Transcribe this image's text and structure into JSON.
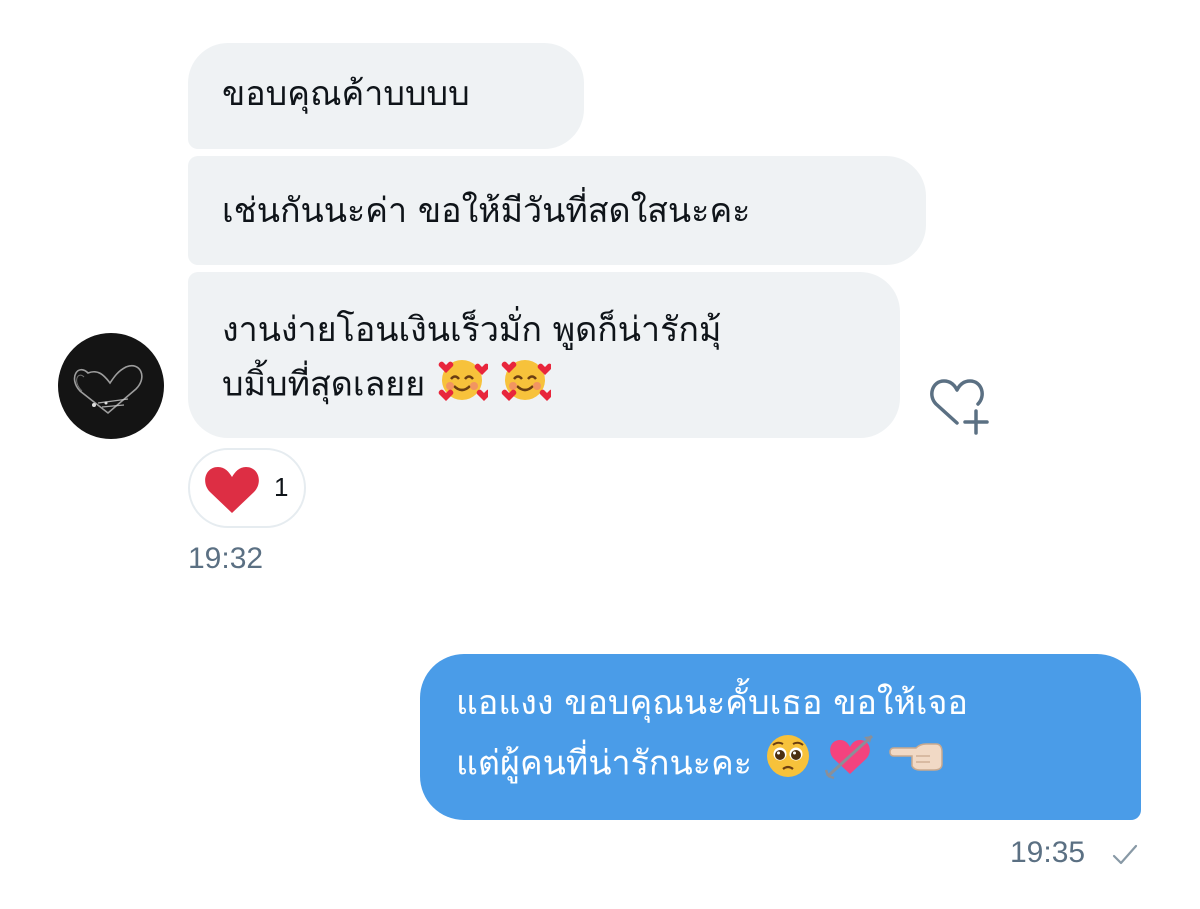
{
  "incoming": {
    "messages": [
      {
        "lines": [
          "ขอบคุณค้าบบบบ"
        ]
      },
      {
        "lines": [
          "เช่นกันนะค่า ขอให้มีวันที่สดใสนะคะ"
        ]
      },
      {
        "lines": [
          "งานง่ายโอนเงินเร็วมั่ก พูดก็น่ารักมุ้",
          "บมิ้บที่สุดเลยย"
        ],
        "emoji": [
          "smiling-face-with-hearts-icon",
          "smiling-face-with-hearts-icon"
        ]
      }
    ],
    "reaction": {
      "emoji": "red-heart-icon",
      "count": "1"
    },
    "timestamp": "19:32"
  },
  "outgoing": {
    "message": {
      "lines": [
        "แอแงง ขอบคุณนะคั้บเธอ ขอให้เจอ",
        "แต่ผู้คนที่น่ารักนะคะ"
      ],
      "emoji": [
        "pleading-face-icon",
        "heart-with-arrow-icon",
        "backhand-index-pointing-left-icon"
      ]
    },
    "timestamp": "19:35"
  },
  "colors": {
    "incoming_bubble": "#eff2f4",
    "outgoing_bubble": "#4a9ce8",
    "timestamp": "#5b7083",
    "heart": "#e0245e"
  }
}
